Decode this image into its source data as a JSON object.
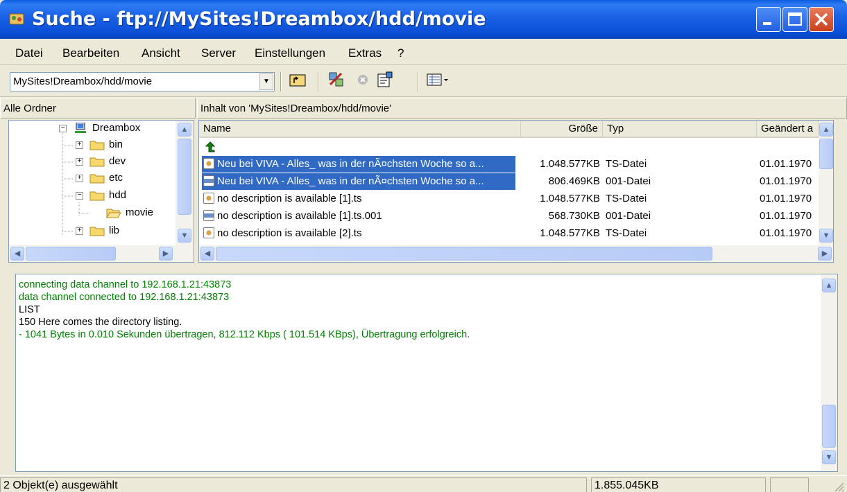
{
  "window": {
    "title": "Suche - ftp://MySites!Dreambox/hdd/movie",
    "app_icon": "suche-app-icon",
    "controls": [
      "minimize-icon",
      "maximize-icon",
      "close-icon"
    ]
  },
  "menu": [
    "Datei",
    "Bearbeiten",
    "Ansicht",
    "Server",
    "Einstellungen",
    "Extras",
    "?"
  ],
  "toolbar": {
    "address_value": "MySites!Dreambox/hdd/movie",
    "icons": [
      "up-folder-icon",
      "disconnect-icon",
      "stop-icon",
      "properties-icon",
      "view-menu-icon"
    ]
  },
  "tree_header": "Alle Ordner",
  "list_header": "Inhalt von 'MySites!Dreambox/hdd/movie'",
  "tree": [
    {
      "label": "Dreambox",
      "icon": "server-icon",
      "expander": "−"
    },
    {
      "label": "bin",
      "icon": "folder-icon",
      "expander": "+"
    },
    {
      "label": "dev",
      "icon": "folder-icon",
      "expander": "+"
    },
    {
      "label": "etc",
      "icon": "folder-icon",
      "expander": "+"
    },
    {
      "label": "hdd",
      "icon": "folder-icon",
      "expander": "−"
    },
    {
      "label": "movie",
      "icon": "open-folder-icon",
      "expander": ""
    },
    {
      "label": "lib",
      "icon": "folder-icon",
      "expander": "+"
    }
  ],
  "columns": {
    "name": "Name",
    "size": "Größe",
    "type": "Typ",
    "modified": "Geändert a"
  },
  "files": [
    {
      "name": "Neu bei VIVA - Alles_ was in der nÃ¤chsten Woche so a...",
      "size": "1.048.577KB",
      "type": "TS-Datei",
      "modified": "01.01.1970",
      "selected": true,
      "icon": "ts-file-icon"
    },
    {
      "name": "Neu bei VIVA - Alles_ was in der nÃ¤chsten Woche so a...",
      "size": "806.469KB",
      "type": "001-Datei",
      "modified": "01.01.1970",
      "selected": true,
      "icon": "001-file-icon"
    },
    {
      "name": "no description is available [1].ts",
      "size": "1.048.577KB",
      "type": "TS-Datei",
      "modified": "01.01.1970",
      "selected": false,
      "icon": "ts-file-icon"
    },
    {
      "name": "no description is available [1].ts.001",
      "size": "568.730KB",
      "type": "001-Datei",
      "modified": "01.01.1970",
      "selected": false,
      "icon": "001-file-icon"
    },
    {
      "name": "no description is available [2].ts",
      "size": "1.048.577KB",
      "type": "TS-Datei",
      "modified": "01.01.1970",
      "selected": false,
      "icon": "ts-file-icon"
    }
  ],
  "log": [
    {
      "text": "connecting data channel to 192.168.1.21:43873",
      "color": "#008000"
    },
    {
      "text": "data channel connected to 192.168.1.21:43873",
      "color": "#008000"
    },
    {
      "text": "LIST",
      "color": "#000000"
    },
    {
      "text": "150 Here comes the directory listing.",
      "color": "#000000"
    },
    {
      "text": "- 1041 Bytes in 0.010 Sekunden übertragen, 812.112 Kbps ( 101.514 KBps), Übertragung erfolgreich.",
      "color": "#008000"
    }
  ],
  "status": {
    "selection": "2 Objekt(e) ausgewählt",
    "total_size": "1.855.045KB"
  },
  "colors": {
    "titlebar": "#0a4fd6",
    "selection": "#316ac5",
    "log_success": "#008000"
  }
}
